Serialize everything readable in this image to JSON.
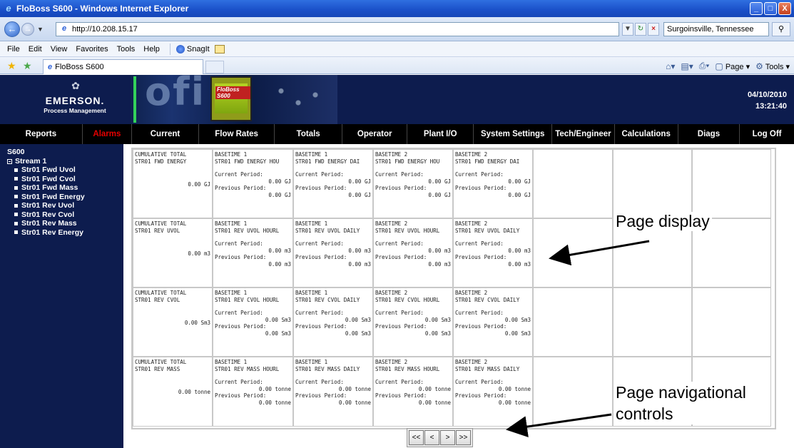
{
  "window": {
    "title": "FloBoss S600 - Windows Internet Explorer",
    "controls": [
      "_",
      "□",
      "X"
    ]
  },
  "addressbar": {
    "url": "http://10.208.15.17",
    "search_value": "Surgoinsville, Tennessee"
  },
  "menubar": {
    "items": [
      "File",
      "Edit",
      "View",
      "Favorites",
      "Tools",
      "Help"
    ],
    "snagit_label": "SnagIt"
  },
  "tabbar": {
    "tab_title": "FloBoss S600",
    "commands": {
      "page": "Page",
      "tools": "Tools"
    }
  },
  "header": {
    "brand": "EMERSON.",
    "brand_sub": "Process Management",
    "device_label": "FloBoss S600",
    "date": "04/10/2010",
    "time": "13:21:40"
  },
  "nav": {
    "items": [
      "Reports",
      "Alarms",
      "Current",
      "Flow Rates",
      "Totals",
      "Operator",
      "Plant I/O",
      "System Settings",
      "Tech/Engineer",
      "Calculations",
      "Diags",
      "Log Off"
    ]
  },
  "sidebar": {
    "root": "S600",
    "stream": "Stream 1",
    "items": [
      "Str01 Fwd Uvol",
      "Str01 Fwd Cvol",
      "Str01 Fwd Mass",
      "Str01 Fwd Energy",
      "Str01 Rev Uvol",
      "Str01 Rev Cvol",
      "Str01 Rev Mass",
      "Str01 Rev Energy"
    ]
  },
  "grid": {
    "rows": [
      {
        "cumulative": {
          "title": "CUMULATIVE TOTAL",
          "name": "STR01 FWD ENERGY",
          "value": "0.00 GJ"
        },
        "periods": [
          {
            "base": "BASETIME 1",
            "name": "STR01 FWD ENERGY HOU",
            "current_label": "Current Period:",
            "current": "0.00 GJ",
            "previous_label": "Previous Period:",
            "previous": "0.00 GJ"
          },
          {
            "base": "BASETIME 1",
            "name": "STR01 FWD ENERGY DAI",
            "current_label": "Current Period:",
            "current": "0.00 GJ",
            "previous_label": "Previous Period:",
            "previous": "0.00 GJ"
          },
          {
            "base": "BASETIME 2",
            "name": "STR01 FWD ENERGY HOU",
            "current_label": "Current Period:",
            "current": "0.00 GJ",
            "previous_label": "Previous Period:",
            "previous": "0.00 GJ"
          },
          {
            "base": "BASETIME 2",
            "name": "STR01 FWD ENERGY DAI",
            "current_label": "Current Period:",
            "current": "0.00 GJ",
            "previous_label": "Previous Period:",
            "previous": "0.00 GJ"
          }
        ]
      },
      {
        "cumulative": {
          "title": "CUMULATIVE TOTAL",
          "name": "STR01 REV UVOL",
          "value": "0.00 m3"
        },
        "periods": [
          {
            "base": "BASETIME 1",
            "name": "STR01 REV UVOL HOURL",
            "current_label": "Current Period:",
            "current": "0.00 m3",
            "previous_label": "Previous Period:",
            "previous": "0.00 m3"
          },
          {
            "base": "BASETIME 1",
            "name": "STR01 REV UVOL DAILY",
            "current_label": "Current Period:",
            "current": "0.00 m3",
            "previous_label": "Previous Period:",
            "previous": "0.00 m3"
          },
          {
            "base": "BASETIME 2",
            "name": "STR01 REV UVOL HOURL",
            "current_label": "Current Period:",
            "current": "0.00 m3",
            "previous_label": "Previous Period:",
            "previous": "0.00 m3"
          },
          {
            "base": "BASETIME 2",
            "name": "STR01 REV UVOL DAILY",
            "current_label": "Current Period:",
            "current": "0.00 m3",
            "previous_label": "Previous Period:",
            "previous": "0.00 m3"
          }
        ]
      },
      {
        "cumulative": {
          "title": "CUMULATIVE TOTAL",
          "name": "STR01 REV CVOL",
          "value": "0.00 Sm3"
        },
        "periods": [
          {
            "base": "BASETIME 1",
            "name": "STR01 REV CVOL HOURL",
            "current_label": "Current Period:",
            "current": "0.00 Sm3",
            "previous_label": "Previous Period:",
            "previous": "0.00 Sm3"
          },
          {
            "base": "BASETIME 1",
            "name": "STR01 REV CVOL DAILY",
            "current_label": "Current Period:",
            "current": "0.00 Sm3",
            "previous_label": "Previous Period:",
            "previous": "0.00 Sm3"
          },
          {
            "base": "BASETIME 2",
            "name": "STR01 REV CVOL HOURL",
            "current_label": "Current Period:",
            "current": "0.00 Sm3",
            "previous_label": "Previous Period:",
            "previous": "0.00 Sm3"
          },
          {
            "base": "BASETIME 2",
            "name": "STR01 REV CVOL DAILY",
            "current_label": "Current Period:",
            "current": "0.00 Sm3",
            "previous_label": "Previous Period:",
            "previous": "0.00 Sm3"
          }
        ]
      },
      {
        "cumulative": {
          "title": "CUMULATIVE TOTAL",
          "name": "STR01 REV MASS",
          "value": "0.00 tonne"
        },
        "periods": [
          {
            "base": "BASETIME 1",
            "name": "STR01 REV MASS HOURL",
            "current_label": "Current Period:",
            "current": "0.00 tonne",
            "previous_label": "Previous Period:",
            "previous": "0.00 tonne"
          },
          {
            "base": "BASETIME 1",
            "name": "STR01 REV MASS DAILY",
            "current_label": "Current Period:",
            "current": "0.00 tonne",
            "previous_label": "Previous Period:",
            "previous": "0.00 tonne"
          },
          {
            "base": "BASETIME 2",
            "name": "STR01 REV MASS HOURL",
            "current_label": "Current Period:",
            "current": "0.00 tonne",
            "previous_label": "Previous Period:",
            "previous": "0.00 tonne"
          },
          {
            "base": "BASETIME 2",
            "name": "STR01 REV MASS DAILY",
            "current_label": "Current Period:",
            "current": "0.00 tonne",
            "previous_label": "Previous Period:",
            "previous": "0.00 tonne"
          }
        ]
      }
    ]
  },
  "pager": {
    "first": "<<",
    "prev": "<",
    "next": ">",
    "last": ">>"
  },
  "annotations": {
    "page_display": "Page display",
    "nav_controls_line1": "Page navigational",
    "nav_controls_line2": "controls"
  },
  "colors": {
    "brand_navy": "#0d1c4e",
    "nav_black": "#000000",
    "alarm_red": "#e60000"
  }
}
